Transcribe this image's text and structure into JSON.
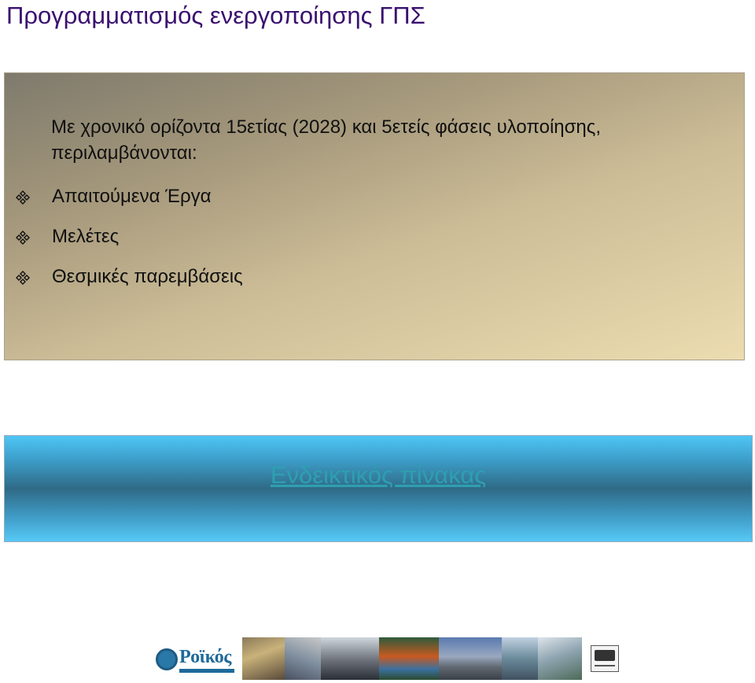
{
  "slide": {
    "title": "Προγραμματισμός ενεργοποίησης ΓΠΣ",
    "intro_text": "Με χρονικό ορίζοντα 15ετίας (2028) και 5ετείς φάσεις υλοποίησης, περιλαμβάνονται:",
    "bullets": [
      {
        "label": "Απαιτούμενα Έργα",
        "icon": "four-diamond-icon"
      },
      {
        "label": "Μελέτες",
        "icon": "four-diamond-icon"
      },
      {
        "label": "Θεσμικές παρεμβάσεις",
        "icon": "four-diamond-icon"
      }
    ],
    "link_label": "Ενδεικτικός πίνακας",
    "footer_logo": "Ροϊκός"
  },
  "colors": {
    "title": "#3a1070",
    "link": "#2e9fb0",
    "banner": "#2f6a86"
  }
}
